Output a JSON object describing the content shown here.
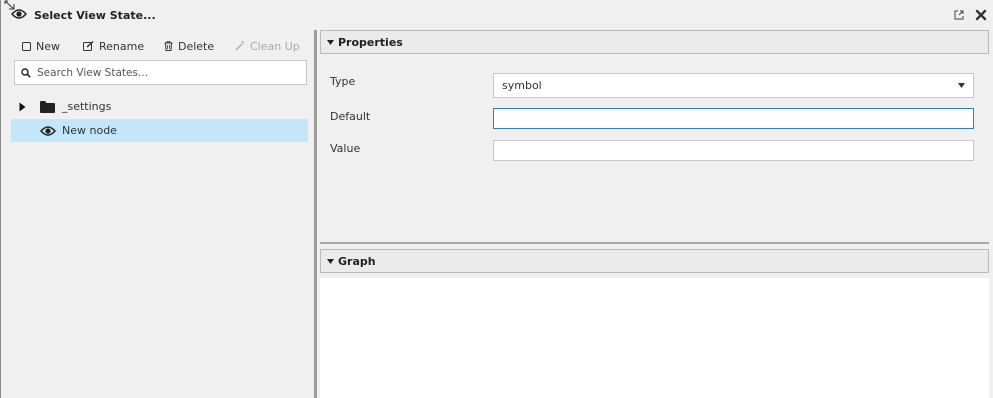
{
  "title": "Select View State...",
  "toolbar": {
    "new_label": "New",
    "rename_label": "Rename",
    "delete_label": "Delete",
    "cleanup_label": "Clean Up"
  },
  "search": {
    "placeholder": "Search View States..."
  },
  "tree": [
    {
      "label": "_settings",
      "icon": "folder-icon",
      "expanded": false
    },
    {
      "label": "New node",
      "icon": "eye-icon",
      "selected": true
    }
  ],
  "properties": {
    "header": "Properties",
    "type_label": "Type",
    "type_value": "symbol",
    "default_label": "Default",
    "default_value": "",
    "value_label": "Value",
    "value_value": ""
  },
  "graph": {
    "header": "Graph"
  },
  "colors": {
    "selection": "#c3e7fa",
    "focus_border": "#2c7fc1",
    "background": "#f0f0f0"
  }
}
